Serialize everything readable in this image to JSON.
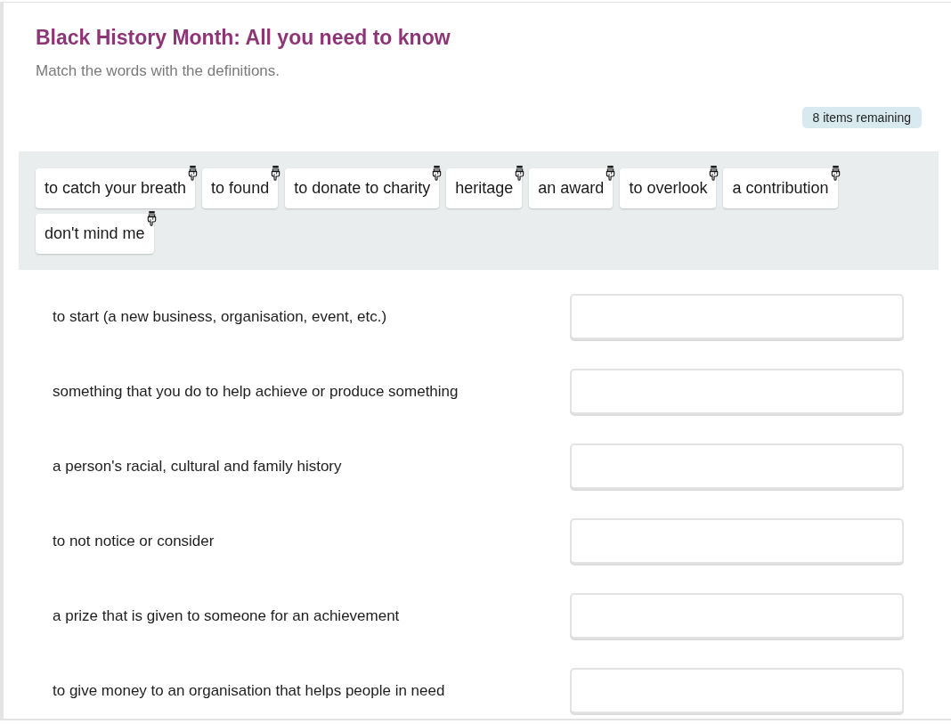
{
  "exercise": {
    "title": "Black History Month: All you need to know",
    "instruction": "Match the words with the definitions."
  },
  "counter": {
    "label": "8 items remaining"
  },
  "word_bank": {
    "items": [
      {
        "label": "to catch your breath"
      },
      {
        "label": "to found"
      },
      {
        "label": "to donate to charity"
      },
      {
        "label": "heritage"
      },
      {
        "label": "an award"
      },
      {
        "label": "to overlook"
      },
      {
        "label": "a contribution"
      },
      {
        "label": "don't mind me"
      }
    ]
  },
  "definitions": [
    {
      "text": "to start (a new business, organisation, event, etc.)"
    },
    {
      "text": "something that you do to help achieve or produce something"
    },
    {
      "text": "a person's racial, cultural and family history"
    },
    {
      "text": "to not notice or consider"
    },
    {
      "text": "a prize that is given to someone for an achievement"
    },
    {
      "text": "to give money to an organisation that helps people in need"
    }
  ]
}
